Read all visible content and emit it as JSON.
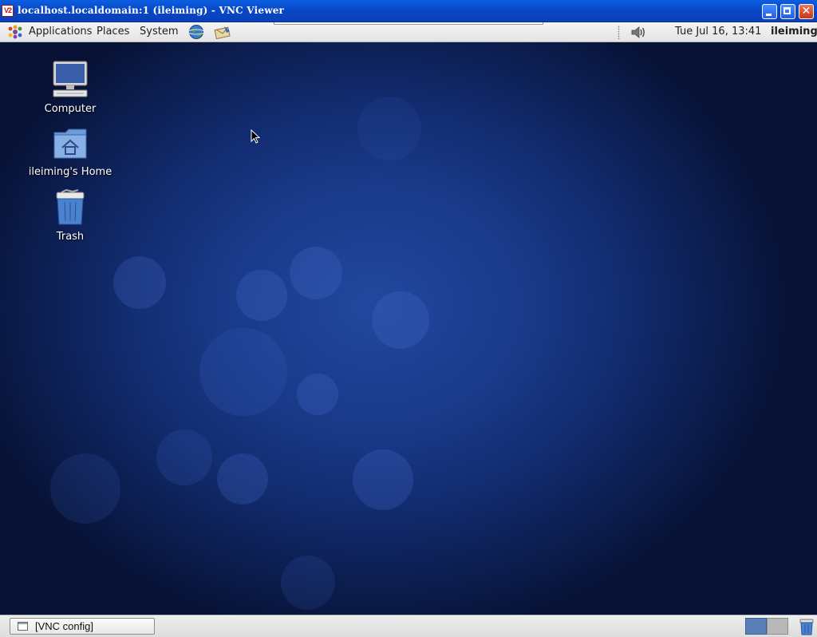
{
  "window": {
    "app_icon": "VNC",
    "title": "localhost.localdomain:1 (ileiming) - VNC Viewer",
    "controls": [
      "minimize-icon",
      "maximize-icon",
      "close-icon"
    ]
  },
  "top_panel": {
    "menus": [
      {
        "label": "Applications",
        "icon": "gnome-foot-icon"
      },
      {
        "label": "Places"
      },
      {
        "label": "System"
      }
    ],
    "launchers": [
      "web-browser-icon",
      "mail-client-icon"
    ],
    "tray": {
      "volume_icon": "volume-icon"
    },
    "clock": "Tue Jul 16, 13:41",
    "user": "ileiming"
  },
  "desktop": {
    "icons": [
      {
        "label": "Computer",
        "icon": "computer-icon"
      },
      {
        "label": "ileiming's Home",
        "icon": "home-folder-icon"
      },
      {
        "label": "Trash",
        "icon": "trash-icon"
      }
    ]
  },
  "bottom_panel": {
    "tasks": [
      {
        "label": "[VNC config]",
        "icon": "window-icon"
      }
    ],
    "workspaces": [
      {
        "active": true,
        "color": "#5a7fb6"
      },
      {
        "active": false,
        "color": "#b8b8b8"
      }
    ],
    "trash_applet_icon": "trash-icon"
  },
  "colors": {
    "desktop_blue": "#1a3a8a",
    "titlebar_blue": "#0848c8",
    "panel_gray": "#e8e8e8"
  }
}
